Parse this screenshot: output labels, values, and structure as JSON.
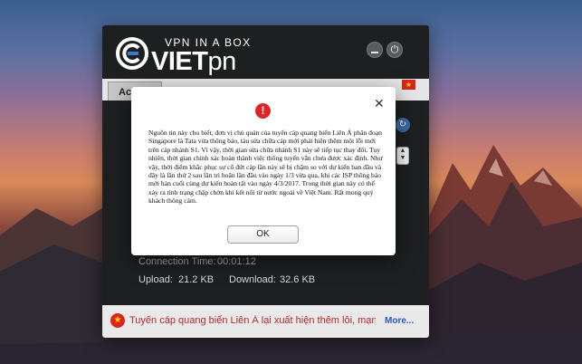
{
  "app": {
    "tagline": "VPN IN A BOX",
    "brand_first": "VIET",
    "brand_rest": "pn",
    "power_glyph": "⏻",
    "tab_active": "Ac"
  },
  "stats": {
    "connection_label": "Connection Time:",
    "connection_value": "00:01:12",
    "upload_label": "Upload:",
    "upload_value": "21.2 KB",
    "download_label": "Download:",
    "download_value": "32.6 KB"
  },
  "news": {
    "text": "Tuyến cáp quang biển Liên Á lại xuất hiện thêm lỗi, mạng tiếp t",
    "more_label": "More..."
  },
  "dialog": {
    "alert_glyph": "!",
    "close_glyph": "✕",
    "message": "Nguồn tin này cho biết, đơn vị chủ quản của tuyến cáp quang biển Liên Á phân đoạn Singapore là Tata vừa thông báo, tàu sửa chữa cáp mới phát hiện thêm một lỗi mới trên cáp nhánh S1. Vì vậy, thời gian sửa chữa nhánh S1 này sẽ tiếp tục thay đổi. Tuy nhiên, thời gian chính xác hoàn thành việc thông tuyến vẫn chưa được xác định. Như vậy, thời điểm khắc phục sự cố đứt cáp lần này sẽ bị chậm so với dự kiến ban đầu và đây là lần thứ 2 sau lần trì hoãn lần đầu vào ngày 1/3 vừa qua, khi các ISP thông báo mới hàn cuối cùng dự kiến hoàn tất vào ngày 4/3/2017. Trong thời gian này có thể xảy ra tình trạng chập chờn khi kết nối từ nước ngoài về Việt Nam. Rất mong quý khách thông cảm.",
    "ok_label": "OK"
  },
  "colors": {
    "news_text": "#b32828",
    "more_link": "#2b59c3",
    "alert": "#e02424"
  }
}
